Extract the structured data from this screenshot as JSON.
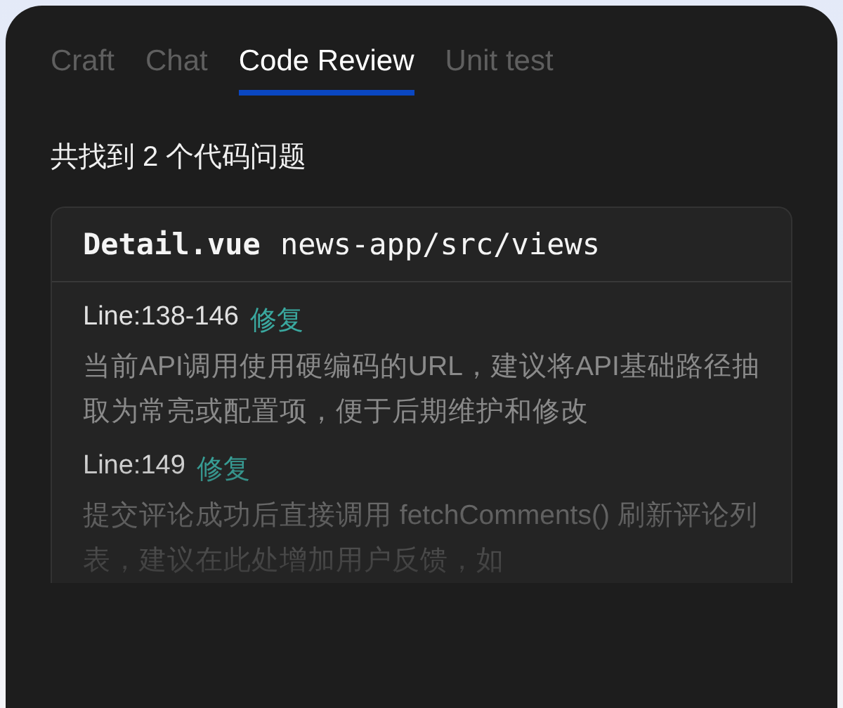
{
  "tabs": [
    {
      "label": "Craft",
      "selected": false
    },
    {
      "label": "Chat",
      "selected": false
    },
    {
      "label": "Code Review",
      "selected": true
    },
    {
      "label": "Unit test",
      "selected": false
    }
  ],
  "summary": "共找到 2 个代码问题",
  "file": {
    "name": "Detail.vue",
    "path": "news-app/src/views"
  },
  "issues": [
    {
      "line": "Line:138-146",
      "action": "修复",
      "description": "当前API调用使用硬编码的URL，建议将API基础路径抽取为常亮或配置项，便于后期维护和修改"
    },
    {
      "line": "Line:149",
      "action": "修复",
      "description": "提交评论成功后直接调用 fetchComments() 刷新评论列表，建议在此处增加用户反馈，如"
    }
  ]
}
